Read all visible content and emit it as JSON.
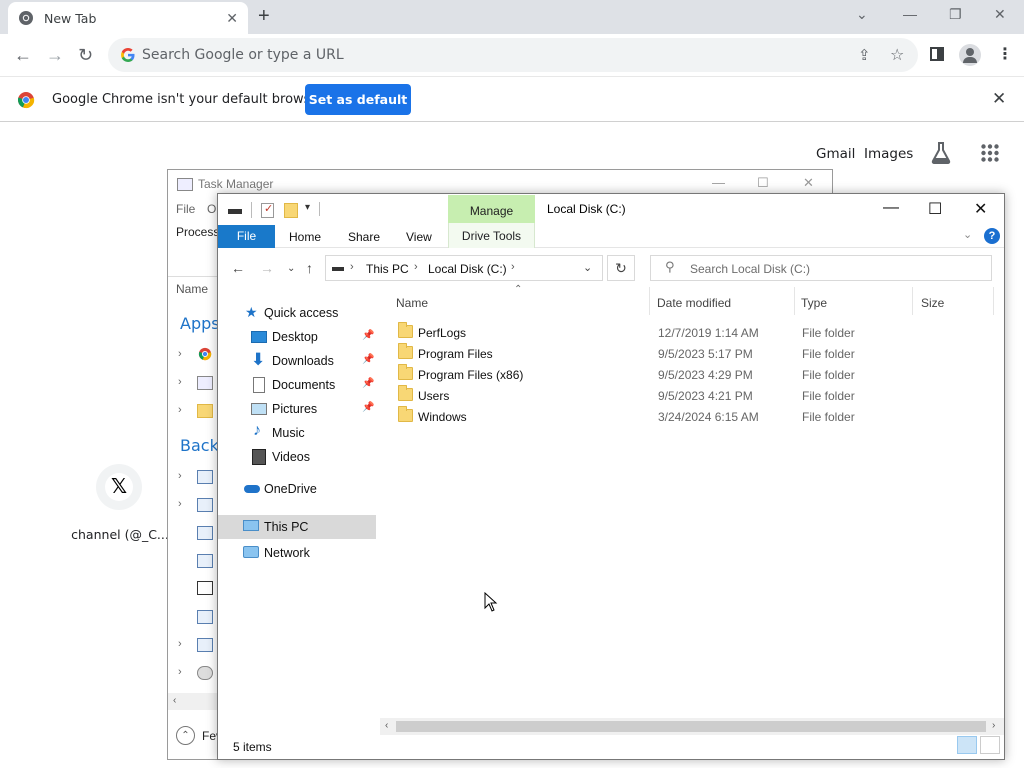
{
  "chrome": {
    "tab_title": "New Tab",
    "tab_close": "✕",
    "new_tab": "+",
    "omnibox_placeholder": "Search Google or type a URL",
    "infobar_message": "Google Chrome isn't your default browser",
    "infobar_button": "Set as default",
    "links": {
      "gmail": "Gmail",
      "images": "Images"
    },
    "shortcut_label": "channel (@_C...",
    "shortcut_glyph": "𝕏"
  },
  "task_manager": {
    "title": "Task Manager",
    "menu": [
      "File",
      "Op"
    ],
    "tab": "Processe",
    "name_col": "Name",
    "groups": [
      "Apps",
      "Backg"
    ],
    "fewer": "Fev"
  },
  "explorer": {
    "manage": "Manage",
    "title": "Local Disk (C:)",
    "ribbon": {
      "file": "File",
      "home": "Home",
      "share": "Share",
      "view": "View",
      "drive_tools": "Drive Tools",
      "help": "?"
    },
    "address": [
      "This PC",
      "Local Disk (C:)"
    ],
    "search_placeholder": "Search Local Disk (C:)",
    "nav": {
      "quick_access": "Quick access",
      "desktop": "Desktop",
      "downloads": "Downloads",
      "documents": "Documents",
      "pictures": "Pictures",
      "music": "Music",
      "videos": "Videos",
      "onedrive": "OneDrive",
      "this_pc": "This PC",
      "network": "Network"
    },
    "columns": {
      "name": "Name",
      "date": "Date modified",
      "type": "Type",
      "size": "Size"
    },
    "rows": [
      {
        "name": "PerfLogs",
        "date": "12/7/2019 1:14 AM",
        "type": "File folder"
      },
      {
        "name": "Program Files",
        "date": "9/5/2023 5:17 PM",
        "type": "File folder"
      },
      {
        "name": "Program Files (x86)",
        "date": "9/5/2023 4:29 PM",
        "type": "File folder"
      },
      {
        "name": "Users",
        "date": "9/5/2023 4:21 PM",
        "type": "File folder"
      },
      {
        "name": "Windows",
        "date": "3/24/2024 6:15 AM",
        "type": "File folder"
      }
    ],
    "status": "5 items"
  }
}
